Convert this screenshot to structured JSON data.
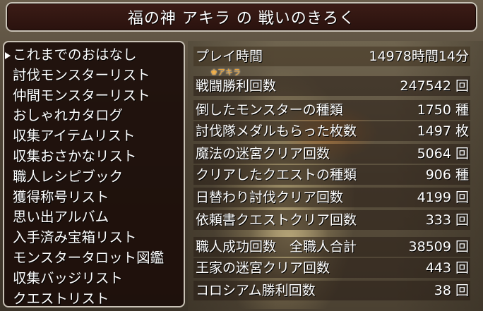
{
  "header": {
    "title": "福の神 アキラ の 戦いのきろく"
  },
  "menu": {
    "selected_index": 0,
    "items": [
      "これまでのおはなし",
      "討伐モンスターリスト",
      "仲間モンスターリスト",
      "おしゃれカタログ",
      "収集アイテムリスト",
      "収集おさかなリスト",
      "職人レシピブック",
      "獲得称号リスト",
      "思い出アルバム",
      "入手済み宝箱リスト",
      "モンスタータロット図鑑",
      "収集バッジリスト",
      "クエストリスト"
    ]
  },
  "character_badge": "♚アキラ",
  "stats": [
    {
      "label": "プレイ時間",
      "value": "14978時間14分"
    },
    {
      "label": "戦闘勝利回数",
      "value": "247542 回"
    },
    {
      "label": "倒したモンスターの種類",
      "value": "1750 種"
    },
    {
      "label": "討伐隊メダルもらった枚数",
      "value": "1497 枚"
    },
    {
      "label": "魔法の迷宮クリア回数",
      "value": "5064 回"
    },
    {
      "label": "クリアしたクエストの種類",
      "value": "906 種"
    },
    {
      "label": "日替わり討伐クリア回数",
      "value": "4199 回"
    },
    {
      "label": "依頼書クエストクリア回数",
      "value": "333 回"
    },
    {
      "label": "職人成功回数　全職人合計",
      "value": "38509 回"
    },
    {
      "label": "王家の迷宮クリア回数",
      "value": "443 回"
    },
    {
      "label": "コロシアム勝利回数",
      "value": "38 回"
    }
  ],
  "colors": {
    "title_bg": "#2a120e",
    "menu_bg": "#1c0e0a",
    "border": "#c9c2b6",
    "text": "#ffffff",
    "badge": "#f3a733"
  }
}
